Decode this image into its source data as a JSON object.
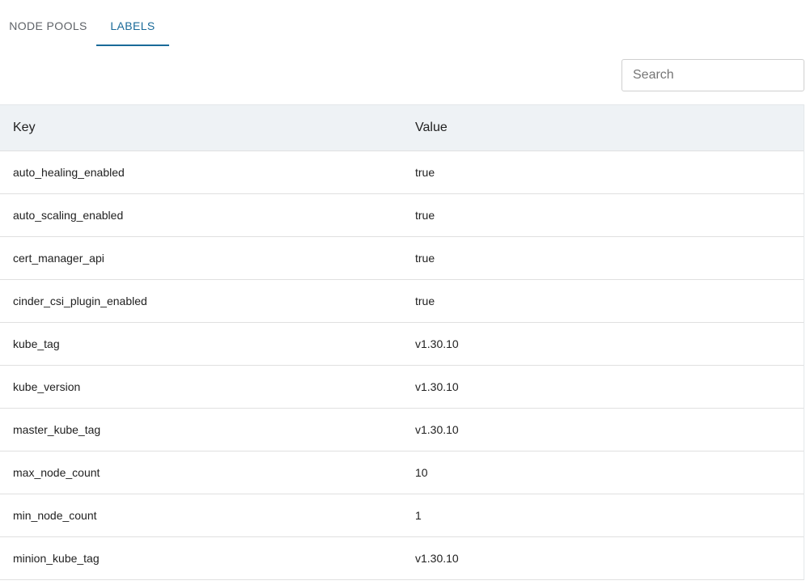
{
  "tabs": [
    {
      "label": "NODE POOLS",
      "active": false
    },
    {
      "label": "LABELS",
      "active": true
    }
  ],
  "accent_color": "#1a6a99",
  "search": {
    "placeholder": "Search",
    "value": ""
  },
  "table": {
    "columns": [
      "Key",
      "Value"
    ],
    "rows": [
      {
        "key": "auto_healing_enabled",
        "value": "true"
      },
      {
        "key": "auto_scaling_enabled",
        "value": "true"
      },
      {
        "key": "cert_manager_api",
        "value": "true"
      },
      {
        "key": "cinder_csi_plugin_enabled",
        "value": "true"
      },
      {
        "key": "kube_tag",
        "value": "v1.30.10"
      },
      {
        "key": "kube_version",
        "value": "v1.30.10"
      },
      {
        "key": "master_kube_tag",
        "value": "v1.30.10"
      },
      {
        "key": "max_node_count",
        "value": "10"
      },
      {
        "key": "min_node_count",
        "value": "1"
      },
      {
        "key": "minion_kube_tag",
        "value": "v1.30.10"
      }
    ]
  }
}
